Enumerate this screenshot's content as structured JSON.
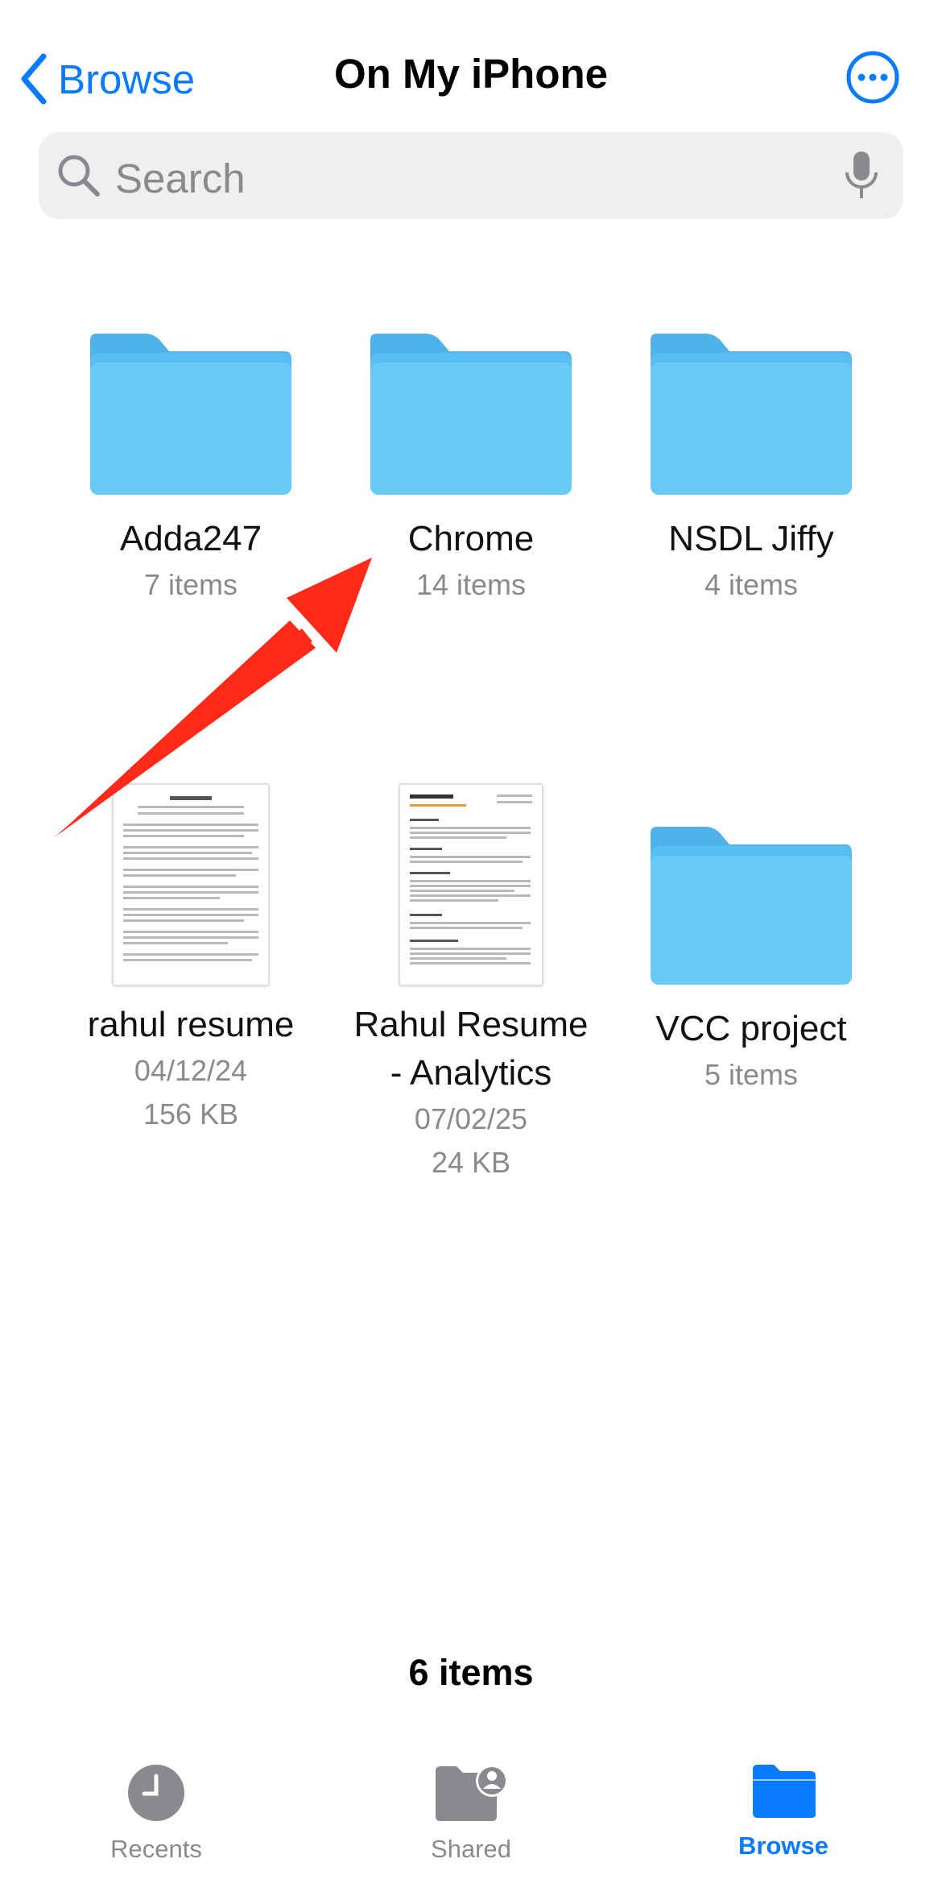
{
  "header": {
    "back_label": "Browse",
    "title": "On My iPhone"
  },
  "search": {
    "placeholder": "Search"
  },
  "items": [
    {
      "name": "Adda247",
      "line1": "7 items",
      "kind": "folder"
    },
    {
      "name": "Chrome",
      "line1": "14 items",
      "kind": "folder"
    },
    {
      "name": "NSDL Jiffy",
      "line1": "4 items",
      "kind": "folder"
    },
    {
      "name": "rahul resume",
      "line1": "04/12/24",
      "line2": "156 KB",
      "kind": "document"
    },
    {
      "name_line1": "Rahul Resume",
      "name_line2": "- Analytics",
      "line1": "07/02/25",
      "line2": "24 KB",
      "kind": "document"
    },
    {
      "name": "VCC project",
      "line1": "5 items",
      "kind": "folder"
    }
  ],
  "footer": {
    "count": "6 items"
  },
  "tabs": [
    {
      "label": "Recents",
      "icon": "clock-icon"
    },
    {
      "label": "Shared",
      "icon": "shared-folder-icon"
    },
    {
      "label": "Browse",
      "icon": "folder-icon",
      "active": true
    }
  ],
  "colors": {
    "accent": "#0a7aff",
    "folder": "#5ec2f2",
    "annotation_arrow": "#ff2a1a"
  },
  "annotation": {
    "arrow_target": "Chrome"
  }
}
